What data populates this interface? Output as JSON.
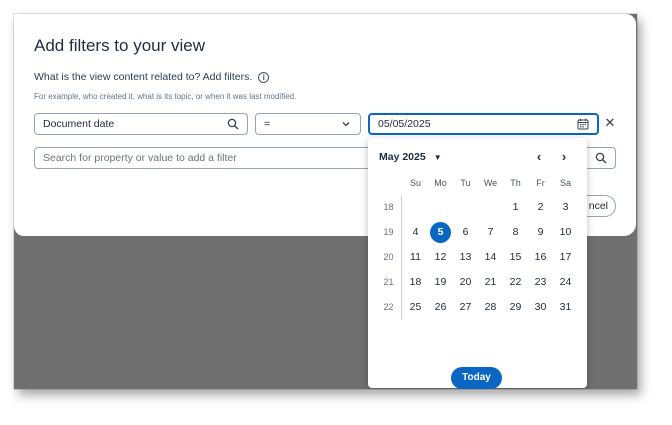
{
  "dialog": {
    "title": "Add filters to your view",
    "question": "What is the view content related to? Add filters.",
    "hint": "For example, who created it, what is its topic, or when it was last modified.",
    "property_value": "Document date",
    "operator_value": "=",
    "date_value": "05/05/2025",
    "search_placeholder": "Search for property or value to add a filter",
    "cancel_label": "ncel"
  },
  "calendar": {
    "month_label": "May 2025",
    "weekdays": [
      "Su",
      "Mo",
      "Tu",
      "We",
      "Th",
      "Fr",
      "Sa"
    ],
    "week_numbers": [
      "18",
      "19",
      "20",
      "21",
      "22"
    ],
    "weeks": [
      [
        "",
        "",
        "",
        "",
        "1",
        "2",
        "3"
      ],
      [
        "4",
        "5",
        "6",
        "7",
        "8",
        "9",
        "10"
      ],
      [
        "11",
        "12",
        "13",
        "14",
        "15",
        "16",
        "17"
      ],
      [
        "18",
        "19",
        "20",
        "21",
        "22",
        "23",
        "24"
      ],
      [
        "25",
        "26",
        "27",
        "28",
        "29",
        "30",
        "31"
      ]
    ],
    "selected_day": "5",
    "today_label": "Today"
  },
  "colors": {
    "accent": "#0a66c2",
    "backdrop": "#707070"
  },
  "icons": {
    "info": "info-icon",
    "search": "search-icon",
    "chevron": "chevron-down-icon",
    "calendar": "calendar-icon",
    "clear": "close-icon"
  }
}
